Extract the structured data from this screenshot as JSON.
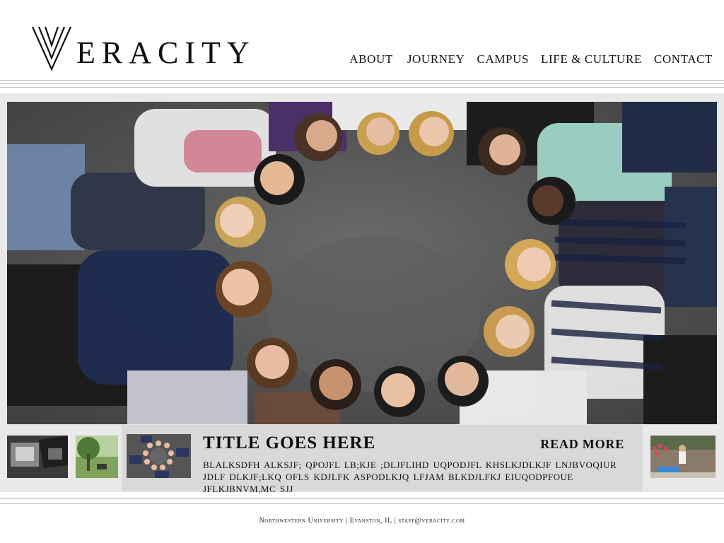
{
  "brand": {
    "name": "ERACITY",
    "logo_icon": "veracity-v-logo"
  },
  "nav": [
    {
      "label": "About"
    },
    {
      "label": "Journey"
    },
    {
      "label": "Campus"
    },
    {
      "label": "Life & Culture"
    },
    {
      "label": "Contact"
    }
  ],
  "hero": {
    "image": "students-lying-in-circle-photo"
  },
  "thumbnails": [
    {
      "image": "black-and-white-photo-thumbnail"
    },
    {
      "image": "park-tree-photo-thumbnail"
    },
    {
      "image": "students-circle-photo-thumbnail"
    },
    {
      "image": "campus-flowers-photo-thumbnail"
    }
  ],
  "feature": {
    "title": "Title Goes Here",
    "read_more": "Read More",
    "body": "blalksdfh alksjf; qpojfl lb;kje ;dljflihd uqpodjfl khslkjdlkjf  lnjbvoqiur jdlf dlkjf;lkq ofls kdjlfk aspodlkjq lfjam blkdjlfkj eiuqodpfoue jflkjbnvm,mc sjj"
  },
  "footer": {
    "text": "Northwestern University | Evanston, IL | staff@veracity.com"
  },
  "colors": {
    "background": "#ffffff",
    "frame": "#e9e9e9",
    "feature_panel": "#d9d9d9",
    "rule": "#bdbdbd",
    "text": "#111111"
  }
}
